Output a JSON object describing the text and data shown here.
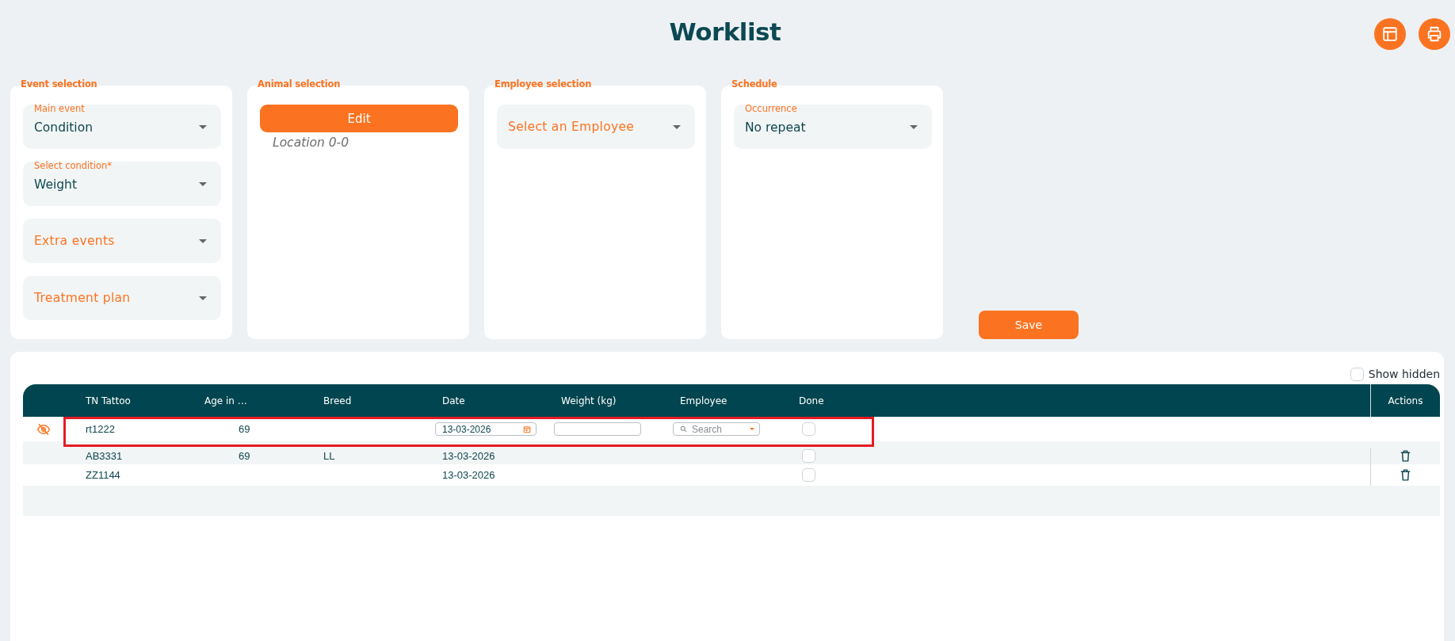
{
  "title": "Worklist",
  "sections": [
    {
      "label": "Event selection",
      "kind": "selects",
      "selects": [
        {
          "label": "Main event",
          "value": "Condition"
        },
        {
          "label": "Select condition*",
          "value": "Weight"
        },
        {
          "placeholder": "Extra events"
        },
        {
          "placeholder": "Treatment plan"
        }
      ]
    },
    {
      "label": "Animal selection",
      "kind": "animals",
      "button": "Edit",
      "location": "Location 0-0"
    },
    {
      "label": "Employee selection",
      "kind": "selects",
      "selects": [
        {
          "placeholder": "Select an Employee"
        }
      ]
    },
    {
      "label": "Schedule",
      "kind": "selects",
      "selects": [
        {
          "label": "Occurrence",
          "value": "No repeat"
        }
      ]
    }
  ],
  "save_button": "Save",
  "show_hidden": {
    "label": "Show hidden",
    "checked": false
  },
  "table": {
    "columns": [
      "TN Tattoo",
      "Age in …",
      "Breed",
      "Date",
      "Weight (kg)",
      "Employee",
      "Done"
    ],
    "actions_label": "Actions",
    "rows": [
      {
        "kind": "edit",
        "highlighted": true,
        "hidden": true,
        "tattoo": "rt1222",
        "age": "69",
        "date": "13-03-2026",
        "employee_placeholder": "Search",
        "done": false
      },
      {
        "kind": "view",
        "highlighted": false,
        "hidden": false,
        "tattoo": "AB3331",
        "age": "69",
        "breed": "LL",
        "date": "13-03-2026",
        "done": false
      },
      {
        "kind": "view",
        "highlighted": false,
        "hidden": false,
        "tattoo": "ZZ1144",
        "date": "13-03-2026",
        "done": false
      }
    ]
  }
}
